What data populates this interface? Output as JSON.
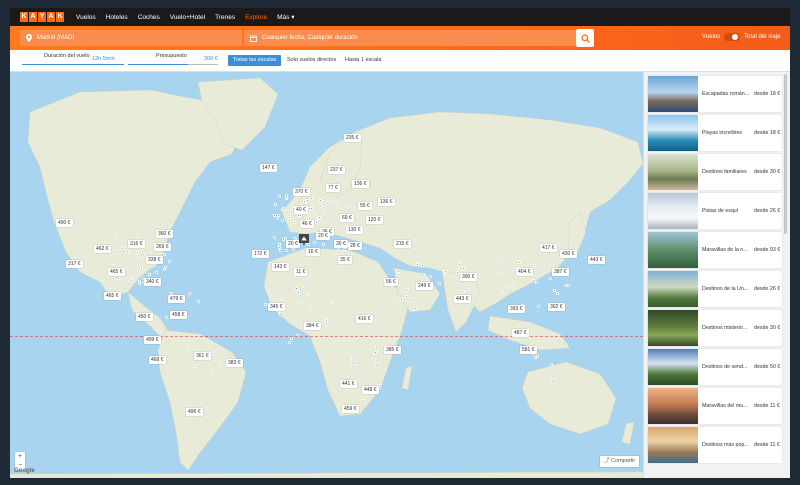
{
  "nav": {
    "logo_letters": [
      "K",
      "A",
      "Y",
      "A",
      "K"
    ],
    "links": [
      "Vuelos",
      "Hoteles",
      "Coches",
      "Vuelo+Hotel",
      "Trenes",
      "Explore",
      "Más"
    ],
    "active": "Explore"
  },
  "search": {
    "origin_value": "Madrid (MAD)",
    "dates_placeholder": "Cualquier fecha, Cualquier duración",
    "toggle_left_label": "Vuelos",
    "toggle_right_label": "Total del viaje"
  },
  "filters": {
    "duration_label": "Duración del vuelo",
    "duration_value": "12h 5min",
    "budget_label": "Presupuesto",
    "budget_value": "300 €",
    "stops": [
      "Todas las escalas",
      "Solo vuelos directos",
      "Hasta 1 escala"
    ],
    "active_stop": "Todas las escalas"
  },
  "map": {
    "zoom_in": "+",
    "zoom_out": "−",
    "attribution": "Google",
    "share_label": "Compartir",
    "price_tags": [
      "235 €",
      "147 €",
      "370 €",
      "237 €",
      "77 €",
      "136 €",
      "136 €",
      "55 €",
      "40 €",
      "120 €",
      "69 €",
      "130 €",
      "46 €",
      "36 €",
      "490 €",
      "360 €",
      "316 €",
      "269 €",
      "215 €",
      "172 €",
      "20 €",
      "16 €",
      "462 €",
      "417 €",
      "430 €",
      "317 €",
      "338 €",
      "143 €",
      "11 €",
      "35 €",
      "443 €",
      "465 €",
      "340 €",
      "56 €",
      "390 €",
      "404 €",
      "387 €",
      "465 €",
      "479 €",
      "345 €",
      "249 €",
      "443 €",
      "302 €",
      "450 €",
      "458 €",
      "384 €",
      "416 €",
      "393 €",
      "499 €",
      "385 €",
      "487 €",
      "468 €",
      "581 €",
      "361 €",
      "383 €",
      "441 €",
      "448 €",
      "496 €",
      "459 €",
      "20 €",
      "30 €",
      "28 €"
    ]
  },
  "sidebar": {
    "cards": [
      {
        "title": "Escapadas román...",
        "price": "desde 18 €"
      },
      {
        "title": "Playas increíbles",
        "price": "desde 18 €"
      },
      {
        "title": "Destinos familiares",
        "price": "desde 30 €"
      },
      {
        "title": "Pistas de esquí",
        "price": "desde 26 €"
      },
      {
        "title": "Maravillas de la n...",
        "price": "desde 93 €"
      },
      {
        "title": "Destinos de la Un...",
        "price": "desde 26 €"
      },
      {
        "title": "Destinos misterio...",
        "price": "desde 30 €"
      },
      {
        "title": "Destinos de send...",
        "price": "desde 50 €"
      },
      {
        "title": "Maravillas del mu...",
        "price": "desde 11 €"
      },
      {
        "title": "Destinos más pop...",
        "price": "desde 11 €"
      }
    ]
  },
  "colors": {
    "brand": "#ff690f",
    "accent_blue": "#3a8fd9",
    "ocean": "#a8d4f0",
    "land": "#e8ebd8"
  }
}
